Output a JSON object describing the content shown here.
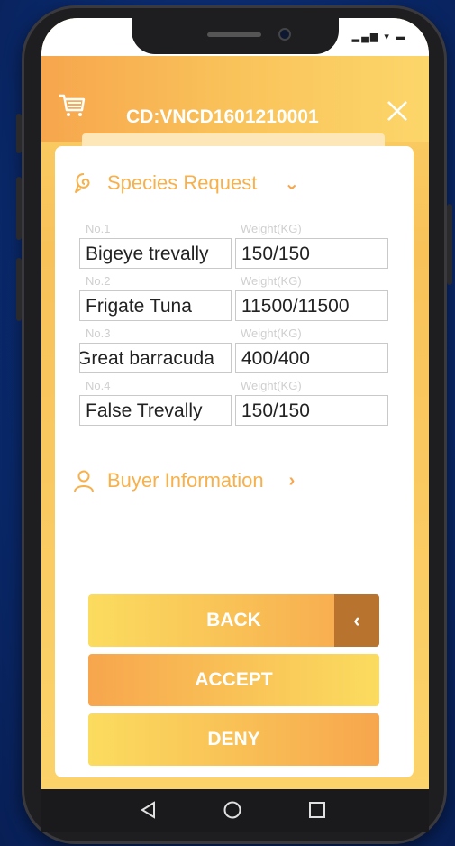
{
  "status_bar": {
    "icons": "▂▄▆ ▾ ▬"
  },
  "header": {
    "title": "CD:VNCD1601210001"
  },
  "species": {
    "section_title": "Species Request",
    "rows": [
      {
        "no": "No.1",
        "weight_label": "Weight(KG)",
        "name": "Bigeye trevally",
        "weight": "150/150"
      },
      {
        "no": "No.2",
        "weight_label": "Weight(KG)",
        "name": "Frigate Tuna",
        "weight": "11500/11500"
      },
      {
        "no": "No.3",
        "weight_label": "Weight(KG)",
        "name": "Great barracuda",
        "weight": "400/400"
      },
      {
        "no": "No.4",
        "weight_label": "Weight(KG)",
        "name": "False Trevally",
        "weight": "150/150"
      }
    ]
  },
  "buyer": {
    "section_title": "Buyer Information"
  },
  "buttons": {
    "back": "BACK",
    "accept": "ACCEPT",
    "deny": "DENY"
  },
  "colors": {
    "accent": "#f7a64d",
    "accent_light": "#fbdc5f",
    "back_arrow": "#b8732f"
  },
  "icons": {
    "header_left": "cart-icon",
    "header_right": "close-icon",
    "species": "fish-icon",
    "buyer": "person-icon",
    "nav": [
      "back-triangle-icon",
      "home-circle-icon",
      "recents-square-icon"
    ]
  }
}
